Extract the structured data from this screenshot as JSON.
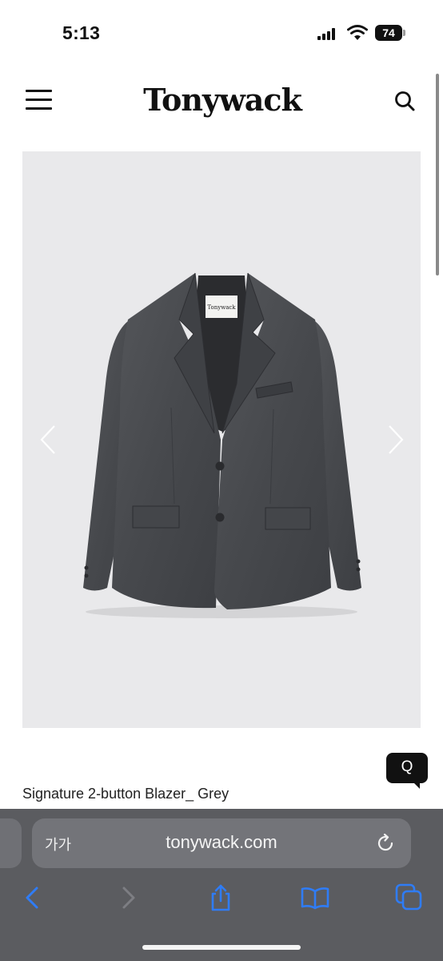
{
  "status_bar": {
    "time": "5:13",
    "battery_level": "74"
  },
  "header": {
    "logo_text": "Tonywack",
    "menu_icon": "hamburger-menu-icon",
    "search_icon": "search-icon"
  },
  "gallery": {
    "image_subject": "grey 2-button blazer",
    "label_text": "Tonywack",
    "prev_icon": "chevron-left-icon",
    "next_icon": "chevron-right-icon"
  },
  "chat": {
    "label": "Q"
  },
  "product": {
    "title": "Signature 2-button Blazer_ Grey"
  },
  "browser": {
    "reader_label": "가가",
    "url": "tonywack.com",
    "back_icon": "back-arrow-icon",
    "forward_icon": "forward-arrow-icon",
    "share_icon": "share-icon",
    "bookmarks_icon": "bookmarks-icon",
    "tabs_icon": "tabs-icon"
  },
  "colors": {
    "accent_blue": "#2f7cf6",
    "toolbar_bg": "#5b5c60",
    "gallery_bg": "#e9e9eb",
    "blazer_grey": "#4a4c50"
  }
}
